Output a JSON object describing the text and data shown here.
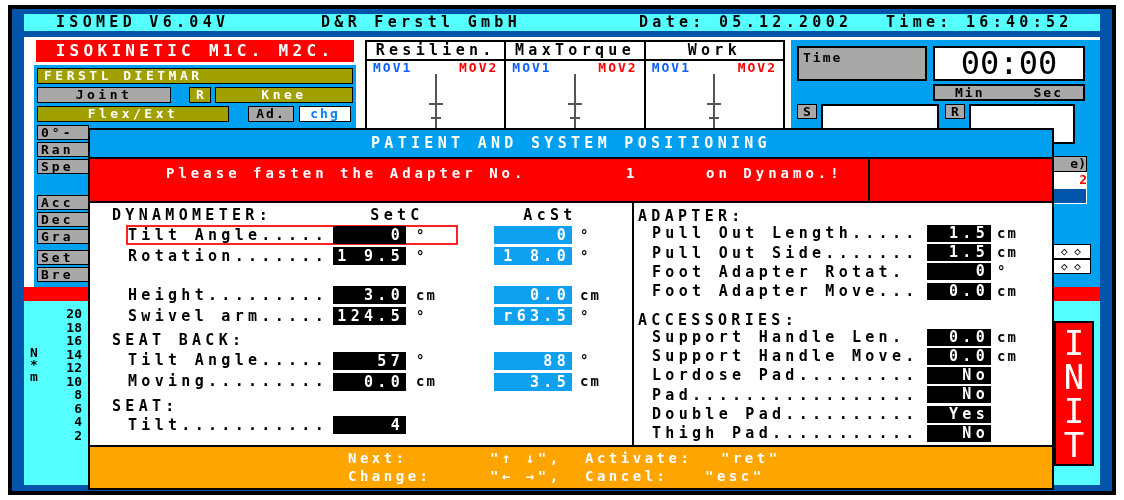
{
  "header": {
    "program": "ISOMED V6.04V",
    "company": "D&R Ferstl GmbH",
    "date": "Date: 05.12.2002",
    "time": "Time: 16:40:52"
  },
  "mode_title": "ISOKINETIC M1C. M2C.",
  "patient": "FERSTL DIETMAR",
  "joint": {
    "label": "Joint",
    "side": "R",
    "name": "Knee"
  },
  "motion": {
    "name": "Flex/Ext",
    "adapter_label": "Ad.",
    "change_button": "chg"
  },
  "parameter_labels_top": [
    "0°-",
    "Ran",
    "Spe"
  ],
  "parameter_labels_bottom": [
    [
      "Acc",
      "Dec",
      "Gra"
    ],
    [
      "Set",
      "Bre"
    ]
  ],
  "graphs": [
    {
      "title": "Resilien.",
      "series": [
        {
          "name": "MOV1",
          "color": "#1060ff"
        },
        {
          "name": "MOV2",
          "color": "#ff0000"
        }
      ]
    },
    {
      "title": "MaxTorque",
      "series": [
        {
          "name": "MOV1",
          "color": "#1060ff"
        },
        {
          "name": "MOV2",
          "color": "#ff0000"
        }
      ]
    },
    {
      "title": "Work",
      "series": [
        {
          "name": "MOV1",
          "color": "#1060ff"
        },
        {
          "name": "MOV2",
          "color": "#ff0000"
        }
      ]
    }
  ],
  "timer": {
    "label": "Time",
    "value": "00:00",
    "units": [
      "Min",
      "Sec"
    ]
  },
  "range_labels": [
    "S",
    "R"
  ],
  "side_panel": {
    "label": "e)",
    "value": "2"
  },
  "diamond_rows": [
    "◇ ◇",
    "◇ ◇"
  ],
  "y_axis": {
    "unit": "N*m",
    "ticks": [
      "20",
      "18",
      "16",
      "14",
      "12",
      "10",
      "8",
      "6",
      "4",
      "2"
    ]
  },
  "init_button": "INIT",
  "dialog": {
    "title": "PATIENT AND SYSTEM POSITIONING",
    "message": [
      "Please fasten the Adapter No.",
      "1",
      "on Dynamo.!"
    ],
    "columns": [
      "SetC",
      "AcSt"
    ],
    "left_sections": [
      {
        "heading": "DYNAMOMETER:",
        "groups": [
          [
            {
              "label": "Tilt Angle.....",
              "selected": true,
              "setc": "0",
              "setc_unit": "°",
              "acst": "0",
              "acst_unit": "°"
            },
            {
              "label": "Rotation.......",
              "selected": false,
              "setc": "1 9.5",
              "setc_unit": "°",
              "acst": "1 8.0",
              "acst_unit": "°"
            }
          ],
          [
            {
              "label": "Height.........",
              "selected": false,
              "setc": "3.0",
              "setc_unit": "cm",
              "acst": "0.0",
              "acst_unit": "cm"
            },
            {
              "label": "Swivel arm.....",
              "selected": false,
              "setc": "124.5",
              "setc_unit": "°",
              "acst": "r63.5",
              "acst_unit": "°"
            }
          ]
        ]
      },
      {
        "heading": "SEAT BACK:",
        "groups": [
          [
            {
              "label": "Tilt Angle.....",
              "selected": false,
              "setc": "57",
              "setc_unit": "°",
              "acst": "88",
              "acst_unit": "°"
            },
            {
              "label": "Moving.........",
              "selected": false,
              "setc": "0.0",
              "setc_unit": "cm",
              "acst": "3.5",
              "acst_unit": "cm"
            }
          ]
        ]
      },
      {
        "heading": "SEAT:",
        "groups": [
          [
            {
              "label": "Tilt...........",
              "selected": false,
              "setc": "4"
            }
          ]
        ]
      }
    ],
    "right_sections": [
      {
        "heading": "ADAPTER:",
        "rows": [
          {
            "label": "Pull Out Length.....",
            "value": "1.5",
            "unit": "cm"
          },
          {
            "label": "Pull Out Side.......",
            "value": "1.5",
            "unit": "cm"
          },
          {
            "label": "Foot Adapter Rotat.",
            "value": "0",
            "unit": "°"
          },
          {
            "label": "Foot Adapter Move...",
            "value": "0.0",
            "unit": "cm"
          }
        ]
      },
      {
        "heading": "ACCESSORIES:",
        "rows": [
          {
            "label": "Support Handle Len.",
            "value": "0.0",
            "unit": "cm"
          },
          {
            "label": "Support Handle Move.",
            "value": "0.0",
            "unit": "cm"
          },
          {
            "label": "Lordose Pad.........",
            "value": "No"
          },
          {
            "label": "Pad.................",
            "value": "No"
          },
          {
            "label": "Double Pad..........",
            "value": "Yes"
          },
          {
            "label": "Thigh Pad...........",
            "value": "No"
          }
        ]
      }
    ],
    "footer": [
      [
        "Next:",
        "\"↑ ↓\",",
        "Activate:",
        "\"ret\""
      ],
      [
        "Change:",
        "\"← →\",",
        "Cancel:",
        "\"esc\""
      ]
    ]
  }
}
